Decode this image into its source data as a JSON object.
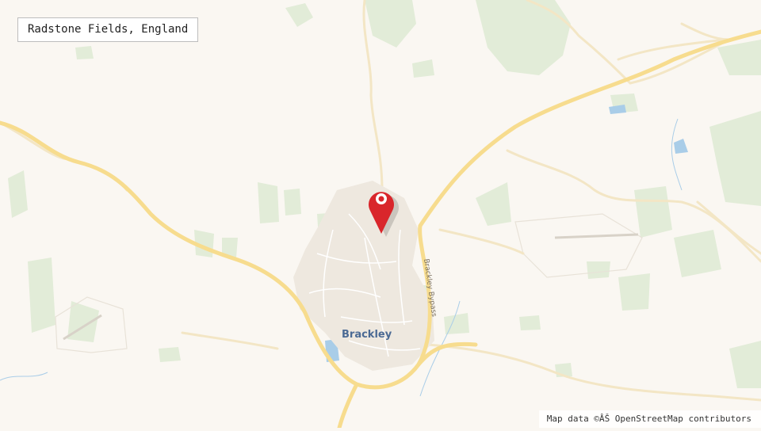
{
  "location": {
    "title": "Radstone Fields, England"
  },
  "map": {
    "town_label": "Brackley",
    "road_label": "Brackley Bypass",
    "attribution": "Map data ©ÂŠ OpenStreetMap contributors",
    "colors": {
      "background": "#faf7f2",
      "greenery": "#e2ecd8",
      "major_road": "#f7dc8e",
      "minor_road": "#f3e6c5",
      "water": "#a9cde8",
      "marker": "#d9262b"
    },
    "icons": {
      "marker": "location-pin-icon"
    }
  }
}
